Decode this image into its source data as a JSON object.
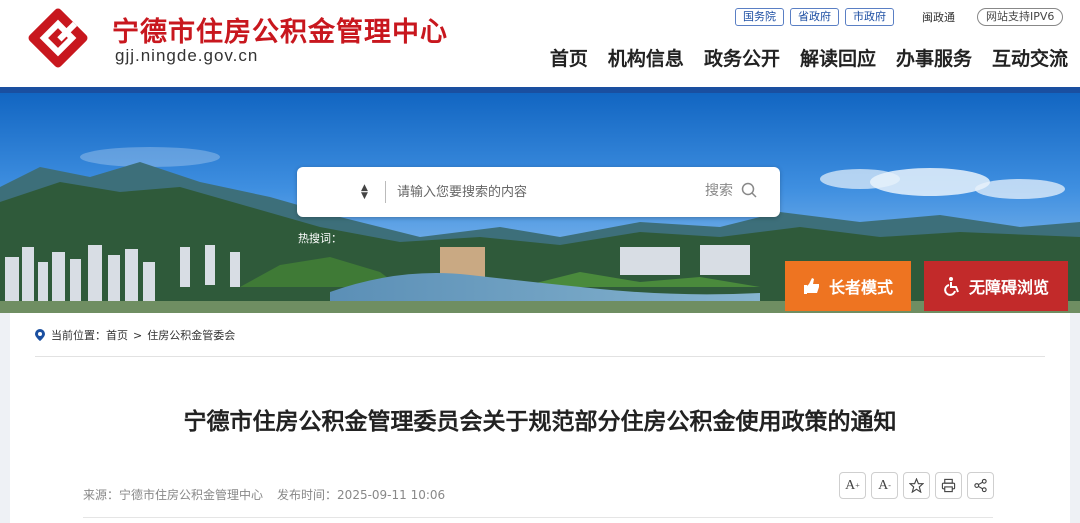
{
  "header": {
    "site_name": "宁德市住房公积金管理中心",
    "domain": "gjj.ningde.gov.cn",
    "gov_links": [
      "国务院",
      "省政府",
      "市政府"
    ],
    "mintong": "闽政通",
    "ipv6": "网站支持IPV6",
    "nav": [
      "首页",
      "机构信息",
      "政务公开",
      "解读回应",
      "办事服务",
      "互动交流"
    ],
    "brand_color": "#c8171e"
  },
  "search": {
    "placeholder": "请输入您要搜索的内容",
    "button_label": "搜索",
    "hotwords_label": "热搜词："
  },
  "modes": {
    "elder": "长者模式",
    "accessible": "无障碍浏览"
  },
  "breadcrumb": {
    "label": "当前位置：",
    "items": [
      "首页",
      "住房公积金管委会"
    ],
    "separator": ">"
  },
  "article": {
    "title": "宁德市住房公积金管理委员会关于规范部分住房公积金使用政策的通知",
    "source_label": "来源：",
    "source": "宁德市住房公积金管理中心",
    "date_label": "发布时间：",
    "date": "2025-09-11 10:06"
  },
  "tools": {
    "font_increase": "A",
    "font_decrease": "A",
    "plus": "+",
    "minus": "-"
  }
}
